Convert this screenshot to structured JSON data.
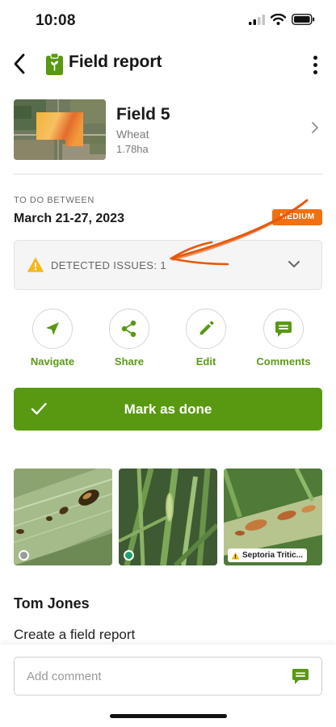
{
  "status_bar": {
    "time": "10:08"
  },
  "header": {
    "title": "Field report"
  },
  "field": {
    "name": "Field 5",
    "crop": "Wheat",
    "area": "1.78ha"
  },
  "schedule": {
    "label": "TO DO BETWEEN",
    "dates": "March 21-27, 2023",
    "priority": "MEDIUM"
  },
  "issues": {
    "label": "DETECTED ISSUES: 1"
  },
  "actions": [
    {
      "label": "Navigate",
      "icon": "navigate-arrow-icon"
    },
    {
      "label": "Share",
      "icon": "share-icon"
    },
    {
      "label": "Edit",
      "icon": "pencil-icon"
    },
    {
      "label": "Comments",
      "icon": "comment-icon"
    }
  ],
  "mark_done": {
    "label": "Mark as done"
  },
  "photos": [
    {
      "status": "none"
    },
    {
      "status": "ok"
    },
    {
      "tag": "Septoria Tritic..."
    }
  ],
  "report": {
    "author": "Tom Jones",
    "action": "Create a field report"
  },
  "comment": {
    "placeholder": "Add comment"
  },
  "colors": {
    "accent": "#599912",
    "priority": "#f1700f",
    "warning": "#f3b81b",
    "annotation": "#e8590c"
  }
}
